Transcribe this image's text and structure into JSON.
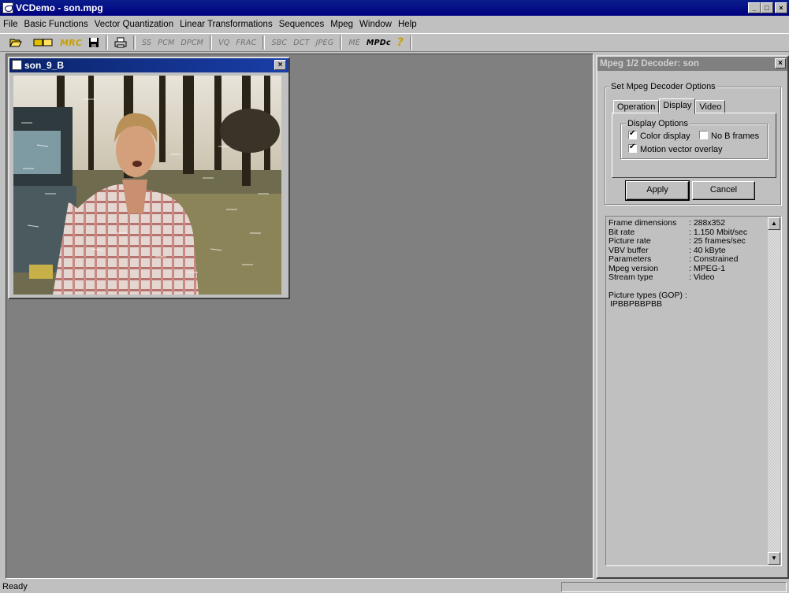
{
  "app": {
    "title": "VCDemo - son.mpg",
    "window_buttons": {
      "minimize": "_",
      "maximize": "□",
      "close": "×"
    }
  },
  "menu": [
    "File",
    "Basic Functions",
    "Vector Quantization",
    "Linear Transformations",
    "Sequences",
    "Mpeg",
    "Window",
    "Help"
  ],
  "toolbar": {
    "open_icon": "folder-open-icon",
    "save_icon": "floppy-disk-icon",
    "print_icon": "printer-icon",
    "mrc_label": "MRC",
    "ss": "SS",
    "pcm": "PCM",
    "dpcm": "DPCM",
    "vq": "VQ",
    "frac": "FRAC",
    "sbc": "SBC",
    "dct": "DCT",
    "jpeg": "JPEG",
    "me": "ME",
    "mpdc": "MPDc",
    "help": "?"
  },
  "child_window": {
    "title": "son_9_B",
    "close": "×"
  },
  "decoder": {
    "title": "Mpeg 1/2 Decoder: son",
    "close": "×",
    "group_label": "Set Mpeg Decoder Options",
    "tabs": [
      "Operation",
      "Display",
      "Video"
    ],
    "active_tab": "Display",
    "display_options_label": "Display Options",
    "color_display": {
      "label": "Color display",
      "checked": true
    },
    "no_b_frames": {
      "label": "No B frames",
      "checked": false
    },
    "motion_vector_overlay": {
      "label": "Motion vector overlay",
      "checked": true
    },
    "apply": "Apply",
    "cancel": "Cancel",
    "info": [
      {
        "k": "Frame dimensions",
        "v": ": 288x352"
      },
      {
        "k": "Bit rate",
        "v": ": 1.150 Mbit/sec"
      },
      {
        "k": "Picture rate",
        "v": ": 25 frames/sec"
      },
      {
        "k": "VBV buffer",
        "v": ": 40 kByte"
      },
      {
        "k": "Parameters",
        "v": ": Constrained"
      },
      {
        "k": "Mpeg version",
        "v": ": MPEG-1"
      },
      {
        "k": "Stream type",
        "v": ": Video"
      }
    ],
    "picture_types_label": "Picture types (GOP) :",
    "picture_types": "IPBBPBBPBB"
  },
  "status": {
    "text": "Ready"
  }
}
